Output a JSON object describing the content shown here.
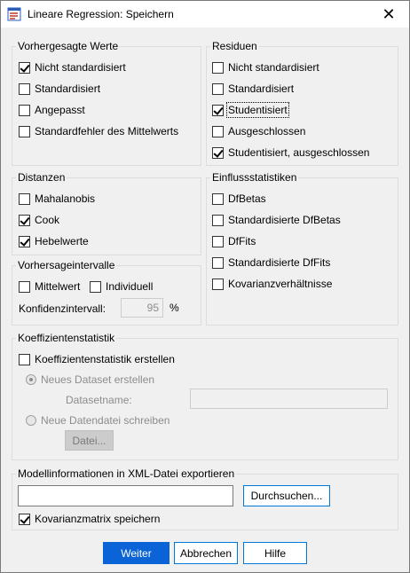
{
  "window": {
    "title": "Lineare Regression: Speichern",
    "close_glyph": "✕",
    "icon": "spss-dialog-icon"
  },
  "predicted": {
    "legend": "Vorhergesagte Werte",
    "items": [
      {
        "label": "Nicht standardisiert",
        "checked": true
      },
      {
        "label": "Standardisiert",
        "checked": false
      },
      {
        "label": "Angepasst",
        "checked": false
      },
      {
        "label": "Standardfehler des Mittelwerts",
        "checked": false
      }
    ]
  },
  "residuals": {
    "legend": "Residuen",
    "items": [
      {
        "label": "Nicht standardisiert",
        "checked": false
      },
      {
        "label": "Standardisiert",
        "checked": false
      },
      {
        "label": "Studentisiert",
        "checked": true
      },
      {
        "label": "Ausgeschlossen",
        "checked": false
      },
      {
        "label": "Studentisiert, ausgeschlossen",
        "checked": true
      }
    ]
  },
  "distances": {
    "legend": "Distanzen",
    "items": [
      {
        "label": "Mahalanobis",
        "checked": false
      },
      {
        "label": "Cook",
        "checked": true
      },
      {
        "label": "Hebelwerte",
        "checked": true
      }
    ]
  },
  "influence": {
    "legend": "Einflussstatistiken",
    "items": [
      {
        "label": "DfBetas",
        "checked": false
      },
      {
        "label": "Standardisierte DfBetas",
        "checked": false
      },
      {
        "label": "DfFits",
        "checked": false
      },
      {
        "label": "Standardisierte DfFits",
        "checked": false
      },
      {
        "label": "Kovarianzverhältnisse",
        "checked": false
      }
    ]
  },
  "prediction_intervals": {
    "legend": "Vorhersageintervalle",
    "mean_label": "Mittelwert",
    "individual_label": "Individuell",
    "ci_label": "Konfidenzintervall:",
    "ci_value": "95",
    "percent": "%"
  },
  "coef_stats": {
    "legend": "Koeffizientenstatistik",
    "create_label": "Koeffizientenstatistik erstellen",
    "new_dataset_label": "Neues Dataset erstellen",
    "dataset_name_label": "Datasetname:",
    "new_file_label": "Neue Datendatei schreiben",
    "file_button": "Datei..."
  },
  "xml_export": {
    "legend": "Modellinformationen in XML-Datei exportieren",
    "path_value": "",
    "browse_button": "Durchsuchen...",
    "cov_matrix_label": "Kovarianzmatrix speichern",
    "cov_matrix_checked": true
  },
  "buttons": {
    "ok": "Weiter",
    "cancel": "Abbrechen",
    "help": "Hilfe"
  }
}
